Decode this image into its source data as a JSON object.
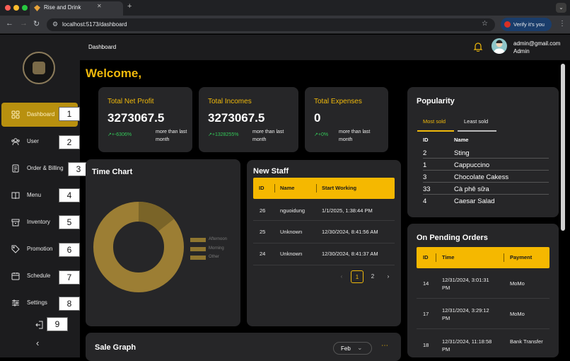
{
  "browser": {
    "tab_title": "Rise and Drink",
    "url": "localhost:5173/dashboard",
    "verify_label": "Verify it's you"
  },
  "header": {
    "breadcrumb": "Dashboard",
    "user_email": "admin@gmail.com",
    "user_role": "Admin"
  },
  "welcome": "Welcome,",
  "sidebar": {
    "items": [
      {
        "label": "Dashboard",
        "icon": "grid-icon",
        "badge": "1",
        "active": true
      },
      {
        "label": "User",
        "icon": "users-icon",
        "badge": "2"
      },
      {
        "label": "Order & Billing",
        "icon": "receipt-icon",
        "badge": "3"
      },
      {
        "label": "Menu",
        "icon": "book-icon",
        "badge": "4"
      },
      {
        "label": "Inventory",
        "icon": "box-icon",
        "badge": "5"
      },
      {
        "label": "Promotion",
        "icon": "tag-icon",
        "badge": "6"
      },
      {
        "label": "Schedule",
        "icon": "calendar-icon",
        "badge": "7"
      },
      {
        "label": "Settings",
        "icon": "sliders-icon",
        "badge": "8"
      }
    ],
    "logout_badge": "9"
  },
  "stats": [
    {
      "title": "Total Net Profit",
      "value": "3273067.5",
      "change": "+-6306%",
      "note": "more than last month"
    },
    {
      "title": "Total Incomes",
      "value": "3273067.5",
      "change": "+1328255%",
      "note": "more than last month"
    },
    {
      "title": "Total Expenses",
      "value": "0",
      "change": "+0%",
      "note": "more than last month"
    }
  ],
  "time_chart": {
    "title": "Time Chart",
    "legend": [
      "Afternoon",
      "Morning",
      "Other"
    ]
  },
  "new_staff": {
    "title": "New Staff",
    "columns": [
      "ID",
      "Name",
      "Start Working"
    ],
    "rows": [
      [
        "26",
        "nguoidung",
        "1/1/2025, 1:38:44 PM"
      ],
      [
        "25",
        "Unknown",
        "12/30/2024, 8:41:56 AM"
      ],
      [
        "24",
        "Unknown",
        "12/30/2024, 8:41:37 AM"
      ]
    ],
    "pages": [
      "1",
      "2"
    ]
  },
  "popularity": {
    "title": "Popularity",
    "tabs": [
      "Most sold",
      "Least sold"
    ],
    "columns": [
      "ID",
      "Name"
    ],
    "rows": [
      [
        "2",
        "Sting"
      ],
      [
        "1",
        "Cappuccino"
      ],
      [
        "3",
        "Chocolate Cakess"
      ],
      [
        "33",
        "Cà phê sữa"
      ],
      [
        "4",
        "Caesar Salad"
      ]
    ]
  },
  "pending": {
    "title": "On Pending Orders",
    "columns": [
      "ID",
      "Time",
      "Payment"
    ],
    "rows": [
      [
        "14",
        "12/31/2024, 3:01:31 PM",
        "MoMo"
      ],
      [
        "17",
        "12/31/2024, 3:29:12 PM",
        "MoMo"
      ],
      [
        "18",
        "12/31/2024, 11:18:58 PM",
        "Bank Transfer"
      ]
    ]
  },
  "sale_graph": {
    "title": "Sale Graph",
    "month": "Feb"
  },
  "colors": {
    "accent": "#f0b90b",
    "sidebar_active": "#b8900f",
    "card": "#262628",
    "positive": "#34c759"
  }
}
